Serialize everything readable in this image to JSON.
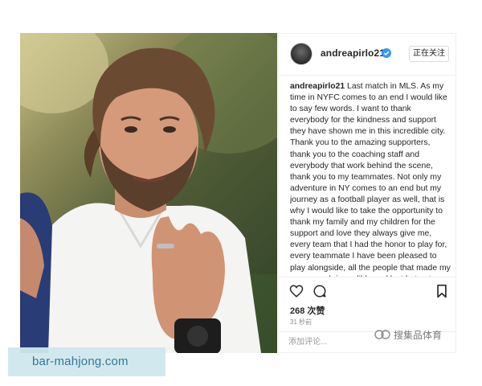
{
  "post": {
    "photo_alt": "andreapirlo21 post photo"
  },
  "header": {
    "username": "andreapirlo21",
    "follow_label": "正在关注"
  },
  "caption": {
    "username": "andreapirlo21",
    "text": " Last match in MLS. As my time in NYFC comes to an end I would like to say few words. I want to thank everybody for the kindness and support they have shown me in this incredible city. Thank you to the amazing supporters, thank you to the coaching staff and everybody that work behind the scene, thank you to my teammates. Not only my adventure in NY comes to an end but my journey as a football player as well, that is why I would like to take the opportunity to thank my family and my children for the support and love they always give me, every team that I had the honor to play for, every teammate I have been pleased to play alongside, all the people that made my career such incredible and last but not least, all the fans around the world that always showed me support. You will"
  },
  "actions": {
    "likes_label": "268 次赞",
    "timestamp": "31 秒前"
  },
  "comment": {
    "placeholder": "添加评论..."
  },
  "watermarks": {
    "sohu": "搜集品体育",
    "site": "bar-mahjong.com"
  },
  "colors": {
    "verified_badge": "#3897f0",
    "site_banner_bg": "#cfe8ee",
    "site_banner_text": "#2d6f8f"
  },
  "icons": [
    "heart-icon",
    "comment-icon",
    "bookmark-icon",
    "verified-icon",
    "sohu-logo-icon"
  ]
}
